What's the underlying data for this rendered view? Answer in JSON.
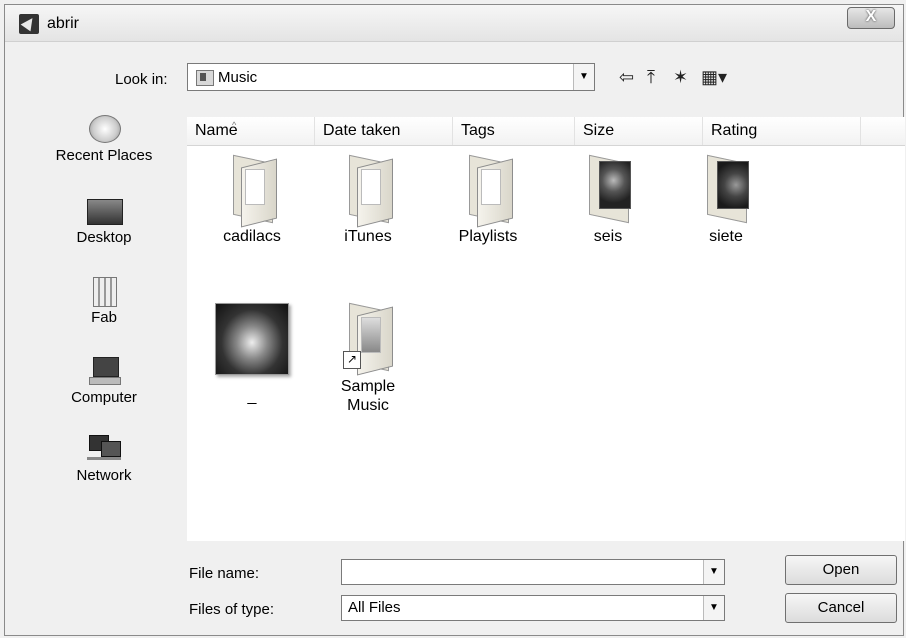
{
  "window": {
    "title": "abrir",
    "close_label": "X"
  },
  "lookin": {
    "label": "Look in:",
    "value": "Music"
  },
  "toolbar": {
    "back_icon": "⇦",
    "up_icon": "⤒",
    "newfolder_icon": "✶",
    "view_icon": "▦▾"
  },
  "sidebar": {
    "items": [
      {
        "label": "Recent Places",
        "icon": "recent-places-icon"
      },
      {
        "label": "Desktop",
        "icon": "desktop-icon"
      },
      {
        "label": "Fab",
        "icon": "user-folder-icon"
      },
      {
        "label": "Computer",
        "icon": "computer-icon"
      },
      {
        "label": "Network",
        "icon": "network-icon"
      }
    ]
  },
  "columns": [
    "Name",
    "Date taken",
    "Tags",
    "Size",
    "Rating"
  ],
  "files": [
    {
      "name": "cadilacs",
      "type": "folder"
    },
    {
      "name": "iTunes",
      "type": "folder"
    },
    {
      "name": "Playlists",
      "type": "folder"
    },
    {
      "name": "seis",
      "type": "album-folder"
    },
    {
      "name": "siete",
      "type": "album-folder"
    },
    {
      "name": "_",
      "type": "image"
    },
    {
      "name": "Sample Music",
      "type": "shortcut-folder"
    }
  ],
  "form": {
    "filename_label": "File name:",
    "filename_value": "",
    "filetype_label": "Files of type:",
    "filetype_value": "All Files",
    "open_label": "Open",
    "cancel_label": "Cancel"
  }
}
